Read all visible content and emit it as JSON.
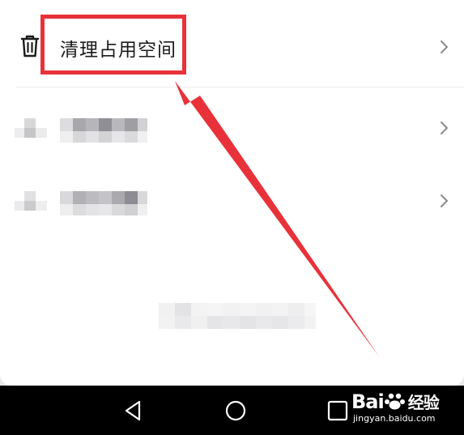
{
  "menu": {
    "items": [
      {
        "icon": "trash-icon",
        "label": "清理占用空间"
      }
    ]
  },
  "watermark": {
    "brand": "Bai",
    "brand_suffix": "经验",
    "site": "jingyan.baidu.com"
  },
  "annotation": {
    "color": "#e8323a"
  }
}
